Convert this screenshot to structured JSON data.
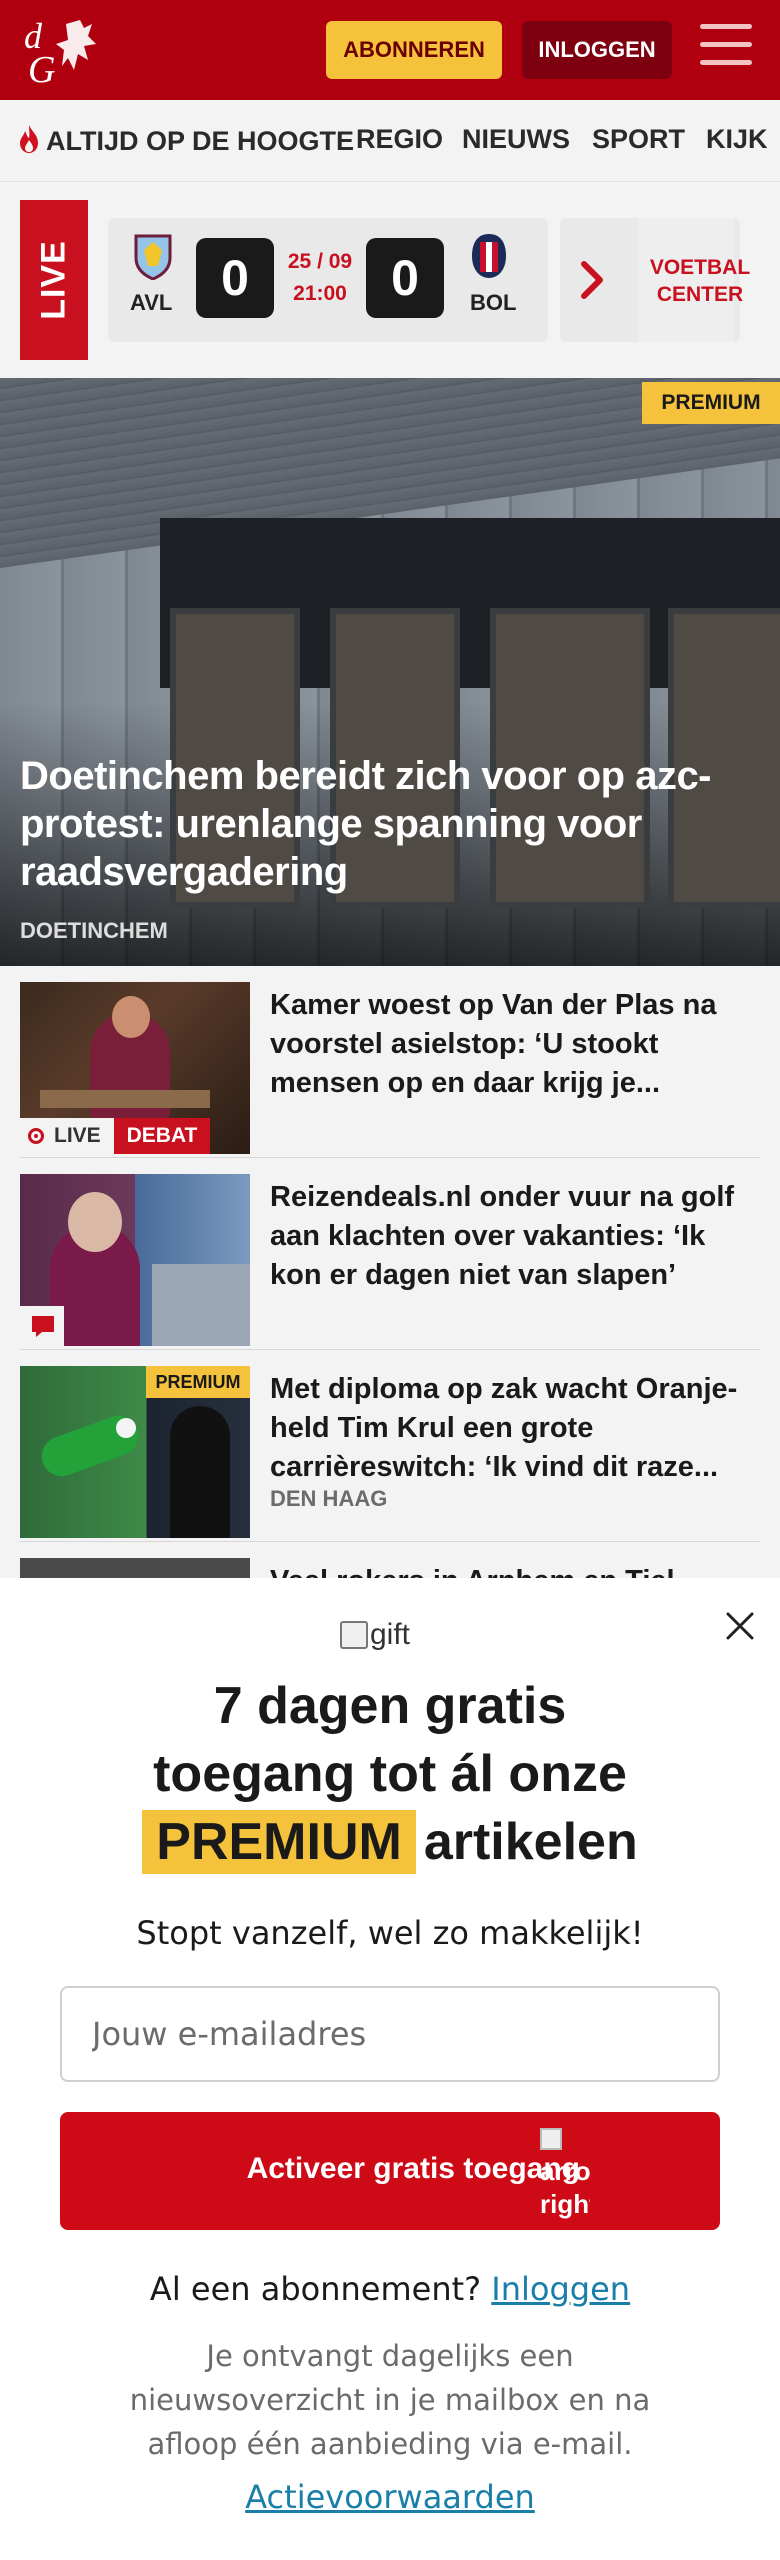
{
  "header": {
    "logo_text": "dG",
    "subscribe_label": "ABONNEREN",
    "login_label": "INLOGGEN",
    "menu_icon": "hamburger-menu-icon",
    "brand_color": "#b0000f",
    "accent_color": "#f5c33b"
  },
  "nav": {
    "items": [
      {
        "label": "ALTIJD OP DE HOOGTE",
        "icon": "flame-icon"
      },
      {
        "label": "REGIO"
      },
      {
        "label": "NIEUWS"
      },
      {
        "label": "SPORT"
      },
      {
        "label": "KIJK"
      }
    ]
  },
  "live": {
    "label": "LIVE",
    "match": {
      "home_code": "AVL",
      "away_code": "BOL",
      "home_score": "0",
      "away_score": "0",
      "date": "25 / 09",
      "time": "21:00"
    },
    "voetbal_center_label": "VOETBAL CENTER"
  },
  "hero": {
    "badge": "PREMIUM",
    "title": "Doetinchem bereidt zich voor op azc-protest: urenlange spanning voor raadsvergadering",
    "location": "DOETINCHEM"
  },
  "articles": [
    {
      "title": "Kamer woest op Van der Plas na voorstel asielstop: ‘U stookt mensen op en daar krijg je...",
      "live_label": "LIVE",
      "tag": "DEBAT"
    },
    {
      "title": "Reizendeals.nl onder vuur na golf aan klachten over vakanties: ‘Ik kon er dagen niet van slapen’",
      "icon": "comment-icon"
    },
    {
      "title": "Met diploma op zak wacht Oranje-held Tim Krul een grote carrièreswitch: ‘Ik vind dit raze...",
      "badge": "PREMIUM",
      "location": "DEN HAAG"
    },
    {
      "title": "Veel rokers in Arnhem en Tiel"
    }
  ],
  "paywall": {
    "gift_alt": "gift",
    "title_line1": "7 dagen gratis",
    "title_line2": "toegang tot ál onze",
    "title_highlight": "PREMIUM",
    "title_line3_rest": "artikelen",
    "subtitle": "Stopt vanzelf, wel zo makkelijk!",
    "email_placeholder": "Jouw e-mailadres",
    "cta_label": "Activeer gratis toegang",
    "cta_img_alt": "arrow-right",
    "have_subscription": "Al een abonnement?",
    "login_link": "Inloggen",
    "info": "Je ontvangt dagelijks een nieuwsoverzicht in je mailbox en na afloop één aanbieding via e-mail.",
    "terms_link": "Actievoorwaarden"
  }
}
